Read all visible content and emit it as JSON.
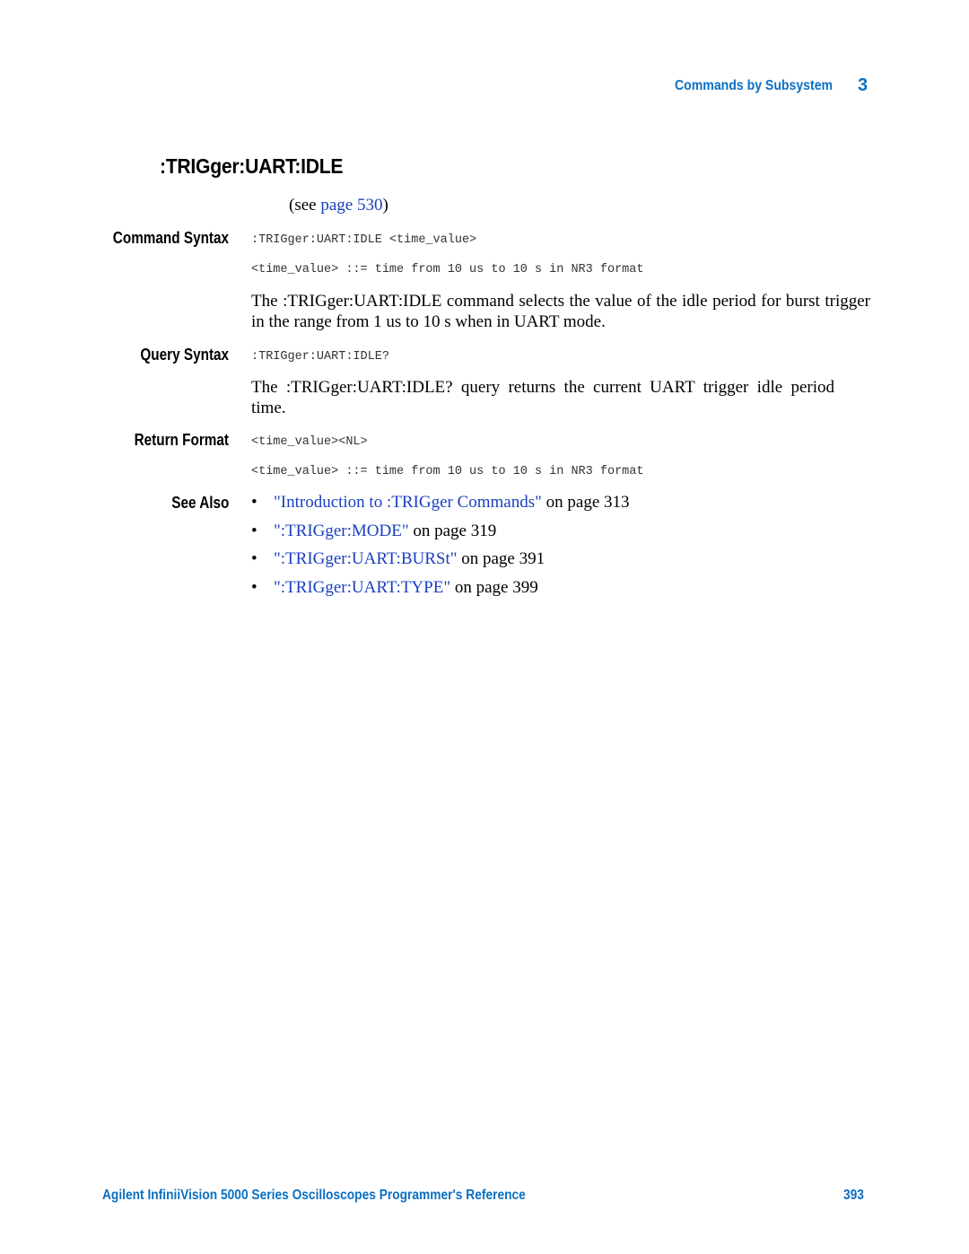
{
  "header": {
    "section": "Commands by Subsystem",
    "chapter": "3"
  },
  "title": ":TRIGger:UART:IDLE",
  "see_page": {
    "prefix": "(see ",
    "link": "page 530",
    "suffix": ")"
  },
  "command_syntax": {
    "label": "Command Syntax",
    "syntax": ":TRIGger:UART:IDLE <time_value>",
    "param": "<time_value> ::= time from 10 us to 10 s in NR3 format",
    "description": "The :TRIGger:UART:IDLE command selects the value of the idle period for burst trigger in the range from 1 us to 10 s when in UART mode."
  },
  "query_syntax": {
    "label": "Query Syntax",
    "syntax": ":TRIGger:UART:IDLE?",
    "description": "The :TRIGger:UART:IDLE? query returns the current UART trigger idle period time."
  },
  "return_format": {
    "label": "Return Format",
    "syntax": "<time_value><NL>",
    "param": "<time_value> ::= time from 10 us to 10 s in NR3 format"
  },
  "see_also": {
    "label": "See Also",
    "bullet": "•",
    "items": [
      {
        "link": "\"Introduction to :TRIGger Commands\"",
        "suffix": " on page 313"
      },
      {
        "link": "\":TRIGger:MODE\"",
        "suffix": " on page 319"
      },
      {
        "link": "\":TRIGger:UART:BURSt\"",
        "suffix": " on page 391"
      },
      {
        "link": "\":TRIGger:UART:TYPE\"",
        "suffix": " on page 399"
      }
    ]
  },
  "footer": {
    "doc_title": "Agilent InfiniiVision 5000 Series Oscilloscopes Programmer's Reference",
    "page_number": "393"
  }
}
